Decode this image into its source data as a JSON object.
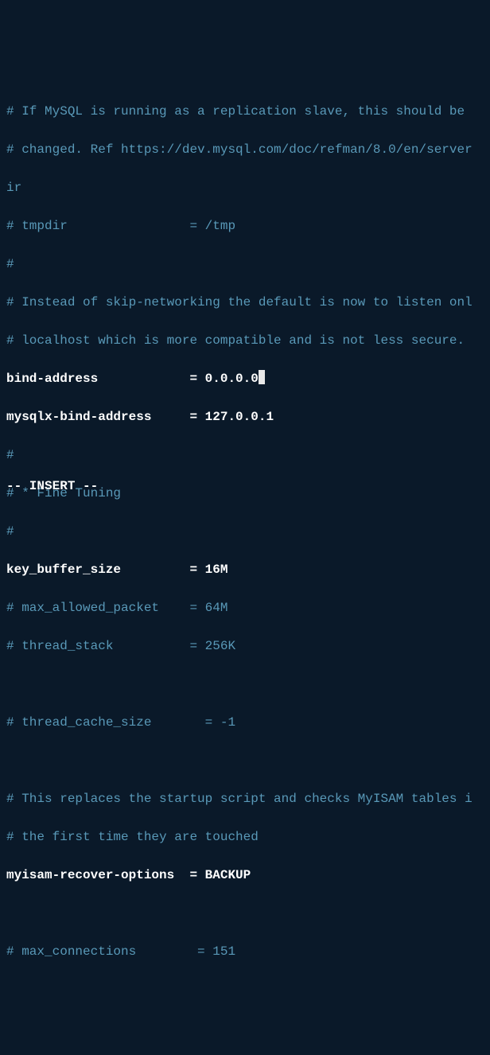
{
  "lines": {
    "l1": "# If MySQL is running as a replication slave, this should be",
    "l2": "# changed. Ref https://dev.mysql.com/doc/refman/8.0/en/server",
    "l2b": "ir",
    "l3": "# tmpdir                = /tmp",
    "l4": "#",
    "l5": "# Instead of skip-networking the default is now to listen onl",
    "l6": "# localhost which is more compatible and is not less secure.",
    "l7a": "bind-address            = 0.0.0.0",
    "l8": "mysqlx-bind-address     = 127.0.0.1",
    "l9": "#",
    "l10": "# * Fine Tuning",
    "l11": "#",
    "l12": "key_buffer_size         = 16M",
    "l13": "# max_allowed_packet    = 64M",
    "l14": "# thread_stack          = 256K",
    "l15": "",
    "l16": "# thread_cache_size       = -1",
    "l17": "",
    "l18": "# This replaces the startup script and checks MyISAM tables i",
    "l19": "# the first time they are touched",
    "l20": "myisam-recover-options  = BACKUP",
    "l21": "",
    "l22": "# max_connections        = 151"
  },
  "mode": "-- INSERT --"
}
